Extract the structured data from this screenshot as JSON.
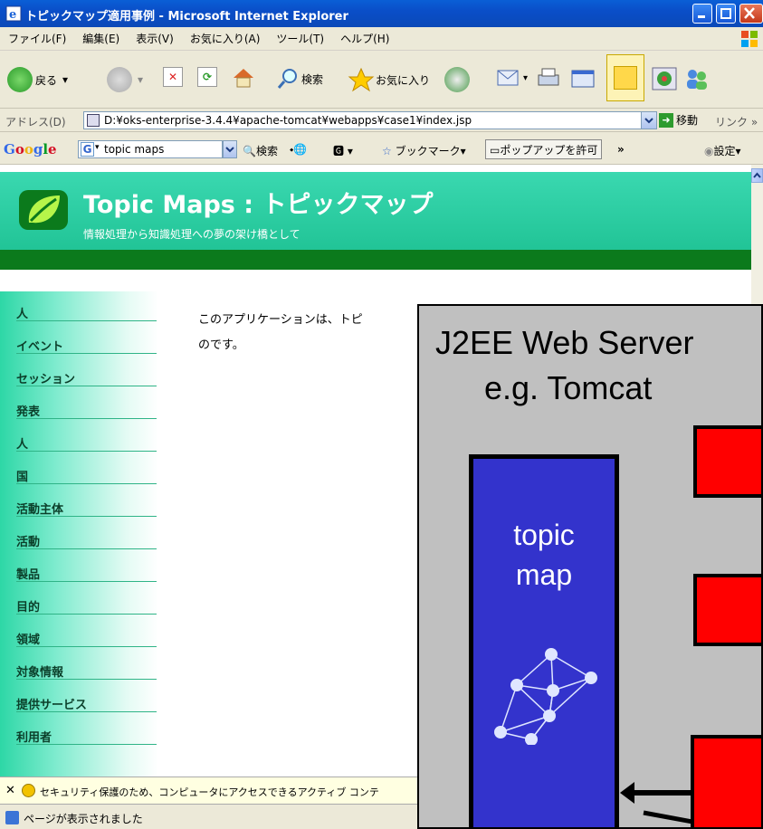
{
  "window": {
    "title": "トピックマップ適用事例 - Microsoft Internet Explorer"
  },
  "menu": [
    "ファイル(F)",
    "編集(E)",
    "表示(V)",
    "お気に入り(A)",
    "ツール(T)",
    "ヘルプ(H)"
  ],
  "toolbar": {
    "back": "戻る",
    "search": "検索",
    "favorites": "お気に入り"
  },
  "address": {
    "label": "アドレス(D)",
    "url": "D:¥oks-enterprise-3.4.4¥apache-tomcat¥webapps¥case1¥index.jsp",
    "go": "移動",
    "links": "リンク »"
  },
  "google": {
    "logo": "Google",
    "query": "topic maps",
    "search": "検索",
    "bookmarks": "ブックマーク▾",
    "popup": "ポップアップを許可",
    "more": "»",
    "settings": "設定▾"
  },
  "page": {
    "title": "Topic Maps : トピックマップ",
    "subtitle": "情報処理から知識処理への夢の架け橋として",
    "nav": [
      "人",
      "イベント",
      "セッション",
      "発表",
      "人",
      "国",
      "活動主体",
      "活動",
      "製品",
      "目的",
      "領域",
      "対象情報",
      "提供サービス",
      "利用者"
    ],
    "body_line1": "このアプリケーションは、トピ",
    "body_line2": "のです。"
  },
  "overlay": {
    "title_line1": "J2EE Web Server",
    "title_line2": "e.g. Tomcat",
    "box_line1": "topic",
    "box_line2": "map"
  },
  "infobar": {
    "text": "セキュリティ保護のため、コンピュータにアクセスできるアクティブ コンテ"
  },
  "status": {
    "text": "ページが表示されました"
  }
}
